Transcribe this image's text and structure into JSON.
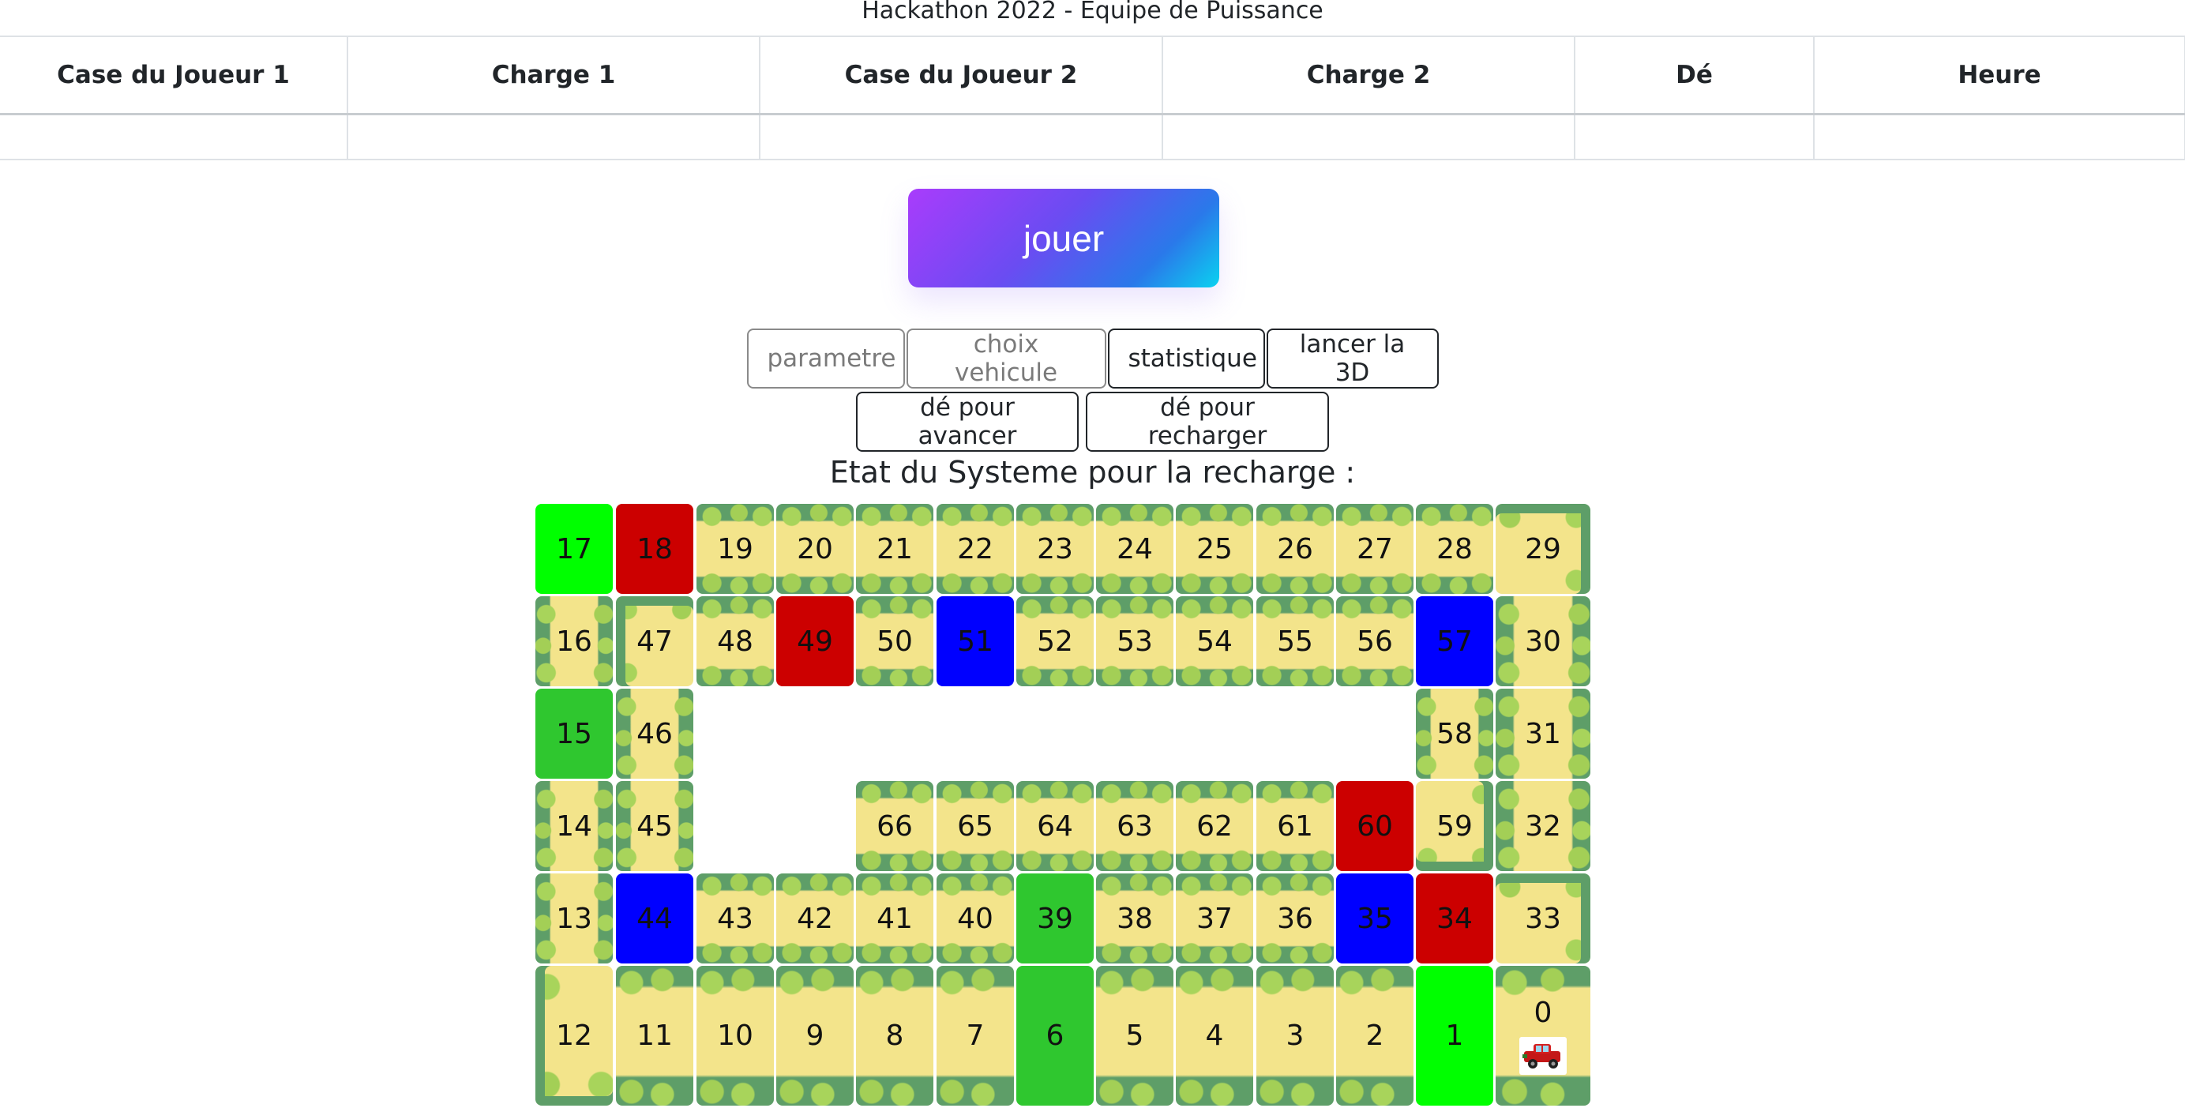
{
  "page_title": "Hackathon 2022 - Equipe de Puissance",
  "table": {
    "headers": [
      "Case du Joueur 1",
      "Charge 1",
      "Case du Joueur 2",
      "Charge 2",
      "Dé",
      "Heure"
    ],
    "row": [
      "",
      "",
      "",
      "",
      "",
      ""
    ]
  },
  "play_button": "jouer",
  "buttons": {
    "parametre": "parametre",
    "choix_vehicule": "choix vehicule",
    "statistique": "statistique",
    "lancer_3d": "lancer la 3D",
    "de_avancer": "dé pour avancer",
    "de_recharger": "dé pour recharger"
  },
  "system_label": "Etat du Systeme pour la recharge :",
  "colors": {
    "bright_green": "#00ff00",
    "green": "#2fc72f",
    "red": "#cc0000",
    "blue": "#0000ff",
    "path_yellow": "#f3e48b",
    "grass": "#5e9e68",
    "button_gradient": [
      "#a93cfc",
      "#2a79ea",
      "#0ad2f0"
    ]
  },
  "board": {
    "cells": {
      "c0": "0",
      "c1": "1",
      "c2": "2",
      "c3": "3",
      "c4": "4",
      "c5": "5",
      "c6": "6",
      "c7": "7",
      "c8": "8",
      "c9": "9",
      "c10": "10",
      "c11": "11",
      "c12": "12",
      "c13": "13",
      "c14": "14",
      "c15": "15",
      "c16": "16",
      "c17": "17",
      "c18": "18",
      "c19": "19",
      "c20": "20",
      "c21": "21",
      "c22": "22",
      "c23": "23",
      "c24": "24",
      "c25": "25",
      "c26": "26",
      "c27": "27",
      "c28": "28",
      "c29": "29",
      "c30": "30",
      "c31": "31",
      "c32": "32",
      "c33": "33",
      "c34": "34",
      "c35": "35",
      "c36": "36",
      "c37": "37",
      "c38": "38",
      "c39": "39",
      "c40": "40",
      "c41": "41",
      "c42": "42",
      "c43": "43",
      "c44": "44",
      "c45": "45",
      "c46": "46",
      "c47": "47",
      "c48": "48",
      "c49": "49",
      "c50": "50",
      "c51": "51",
      "c52": "52",
      "c53": "53",
      "c54": "54",
      "c55": "55",
      "c56": "56",
      "c57": "57",
      "c58": "58",
      "c59": "59",
      "c60": "60",
      "c61": "61",
      "c62": "62",
      "c63": "63",
      "c64": "64",
      "c65": "65",
      "c66": "66"
    },
    "player_icon": "red-car-icon"
  }
}
